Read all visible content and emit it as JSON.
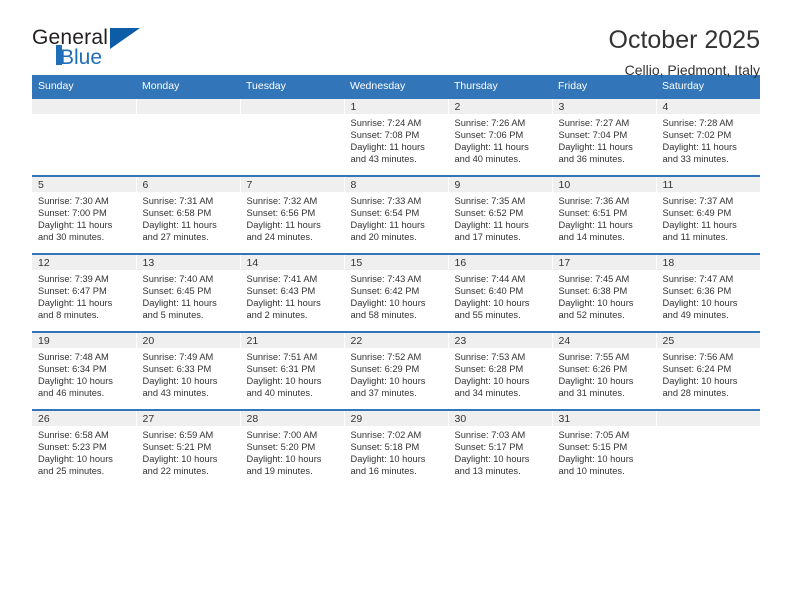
{
  "brand": {
    "name_top": "General",
    "name_bottom": "Blue",
    "accent_color": "#1f6fb8",
    "flag_color": "#0c5ca8"
  },
  "header": {
    "title": "October 2025",
    "location": "Cellio, Piedmont, Italy"
  },
  "theme": {
    "header_row_bg": "#3275b8",
    "daynum_strip_bg": "#efefef",
    "text_color": "#333333"
  },
  "weekday_headers": [
    "Sunday",
    "Monday",
    "Tuesday",
    "Wednesday",
    "Thursday",
    "Friday",
    "Saturday"
  ],
  "weeks": [
    [
      {
        "day": "",
        "empty": true,
        "sunrise": "",
        "sunset": "",
        "daylight_line1": "",
        "daylight_line2": ""
      },
      {
        "day": "",
        "empty": true,
        "sunrise": "",
        "sunset": "",
        "daylight_line1": "",
        "daylight_line2": ""
      },
      {
        "day": "",
        "empty": true,
        "sunrise": "",
        "sunset": "",
        "daylight_line1": "",
        "daylight_line2": ""
      },
      {
        "day": "1",
        "empty": false,
        "sunrise": "Sunrise: 7:24 AM",
        "sunset": "Sunset: 7:08 PM",
        "daylight_line1": "Daylight: 11 hours",
        "daylight_line2": "and 43 minutes."
      },
      {
        "day": "2",
        "empty": false,
        "sunrise": "Sunrise: 7:26 AM",
        "sunset": "Sunset: 7:06 PM",
        "daylight_line1": "Daylight: 11 hours",
        "daylight_line2": "and 40 minutes."
      },
      {
        "day": "3",
        "empty": false,
        "sunrise": "Sunrise: 7:27 AM",
        "sunset": "Sunset: 7:04 PM",
        "daylight_line1": "Daylight: 11 hours",
        "daylight_line2": "and 36 minutes."
      },
      {
        "day": "4",
        "empty": false,
        "sunrise": "Sunrise: 7:28 AM",
        "sunset": "Sunset: 7:02 PM",
        "daylight_line1": "Daylight: 11 hours",
        "daylight_line2": "and 33 minutes."
      }
    ],
    [
      {
        "day": "5",
        "empty": false,
        "sunrise": "Sunrise: 7:30 AM",
        "sunset": "Sunset: 7:00 PM",
        "daylight_line1": "Daylight: 11 hours",
        "daylight_line2": "and 30 minutes."
      },
      {
        "day": "6",
        "empty": false,
        "sunrise": "Sunrise: 7:31 AM",
        "sunset": "Sunset: 6:58 PM",
        "daylight_line1": "Daylight: 11 hours",
        "daylight_line2": "and 27 minutes."
      },
      {
        "day": "7",
        "empty": false,
        "sunrise": "Sunrise: 7:32 AM",
        "sunset": "Sunset: 6:56 PM",
        "daylight_line1": "Daylight: 11 hours",
        "daylight_line2": "and 24 minutes."
      },
      {
        "day": "8",
        "empty": false,
        "sunrise": "Sunrise: 7:33 AM",
        "sunset": "Sunset: 6:54 PM",
        "daylight_line1": "Daylight: 11 hours",
        "daylight_line2": "and 20 minutes."
      },
      {
        "day": "9",
        "empty": false,
        "sunrise": "Sunrise: 7:35 AM",
        "sunset": "Sunset: 6:52 PM",
        "daylight_line1": "Daylight: 11 hours",
        "daylight_line2": "and 17 minutes."
      },
      {
        "day": "10",
        "empty": false,
        "sunrise": "Sunrise: 7:36 AM",
        "sunset": "Sunset: 6:51 PM",
        "daylight_line1": "Daylight: 11 hours",
        "daylight_line2": "and 14 minutes."
      },
      {
        "day": "11",
        "empty": false,
        "sunrise": "Sunrise: 7:37 AM",
        "sunset": "Sunset: 6:49 PM",
        "daylight_line1": "Daylight: 11 hours",
        "daylight_line2": "and 11 minutes."
      }
    ],
    [
      {
        "day": "12",
        "empty": false,
        "sunrise": "Sunrise: 7:39 AM",
        "sunset": "Sunset: 6:47 PM",
        "daylight_line1": "Daylight: 11 hours",
        "daylight_line2": "and 8 minutes."
      },
      {
        "day": "13",
        "empty": false,
        "sunrise": "Sunrise: 7:40 AM",
        "sunset": "Sunset: 6:45 PM",
        "daylight_line1": "Daylight: 11 hours",
        "daylight_line2": "and 5 minutes."
      },
      {
        "day": "14",
        "empty": false,
        "sunrise": "Sunrise: 7:41 AM",
        "sunset": "Sunset: 6:43 PM",
        "daylight_line1": "Daylight: 11 hours",
        "daylight_line2": "and 2 minutes."
      },
      {
        "day": "15",
        "empty": false,
        "sunrise": "Sunrise: 7:43 AM",
        "sunset": "Sunset: 6:42 PM",
        "daylight_line1": "Daylight: 10 hours",
        "daylight_line2": "and 58 minutes."
      },
      {
        "day": "16",
        "empty": false,
        "sunrise": "Sunrise: 7:44 AM",
        "sunset": "Sunset: 6:40 PM",
        "daylight_line1": "Daylight: 10 hours",
        "daylight_line2": "and 55 minutes."
      },
      {
        "day": "17",
        "empty": false,
        "sunrise": "Sunrise: 7:45 AM",
        "sunset": "Sunset: 6:38 PM",
        "daylight_line1": "Daylight: 10 hours",
        "daylight_line2": "and 52 minutes."
      },
      {
        "day": "18",
        "empty": false,
        "sunrise": "Sunrise: 7:47 AM",
        "sunset": "Sunset: 6:36 PM",
        "daylight_line1": "Daylight: 10 hours",
        "daylight_line2": "and 49 minutes."
      }
    ],
    [
      {
        "day": "19",
        "empty": false,
        "sunrise": "Sunrise: 7:48 AM",
        "sunset": "Sunset: 6:34 PM",
        "daylight_line1": "Daylight: 10 hours",
        "daylight_line2": "and 46 minutes."
      },
      {
        "day": "20",
        "empty": false,
        "sunrise": "Sunrise: 7:49 AM",
        "sunset": "Sunset: 6:33 PM",
        "daylight_line1": "Daylight: 10 hours",
        "daylight_line2": "and 43 minutes."
      },
      {
        "day": "21",
        "empty": false,
        "sunrise": "Sunrise: 7:51 AM",
        "sunset": "Sunset: 6:31 PM",
        "daylight_line1": "Daylight: 10 hours",
        "daylight_line2": "and 40 minutes."
      },
      {
        "day": "22",
        "empty": false,
        "sunrise": "Sunrise: 7:52 AM",
        "sunset": "Sunset: 6:29 PM",
        "daylight_line1": "Daylight: 10 hours",
        "daylight_line2": "and 37 minutes."
      },
      {
        "day": "23",
        "empty": false,
        "sunrise": "Sunrise: 7:53 AM",
        "sunset": "Sunset: 6:28 PM",
        "daylight_line1": "Daylight: 10 hours",
        "daylight_line2": "and 34 minutes."
      },
      {
        "day": "24",
        "empty": false,
        "sunrise": "Sunrise: 7:55 AM",
        "sunset": "Sunset: 6:26 PM",
        "daylight_line1": "Daylight: 10 hours",
        "daylight_line2": "and 31 minutes."
      },
      {
        "day": "25",
        "empty": false,
        "sunrise": "Sunrise: 7:56 AM",
        "sunset": "Sunset: 6:24 PM",
        "daylight_line1": "Daylight: 10 hours",
        "daylight_line2": "and 28 minutes."
      }
    ],
    [
      {
        "day": "26",
        "empty": false,
        "sunrise": "Sunrise: 6:58 AM",
        "sunset": "Sunset: 5:23 PM",
        "daylight_line1": "Daylight: 10 hours",
        "daylight_line2": "and 25 minutes."
      },
      {
        "day": "27",
        "empty": false,
        "sunrise": "Sunrise: 6:59 AM",
        "sunset": "Sunset: 5:21 PM",
        "daylight_line1": "Daylight: 10 hours",
        "daylight_line2": "and 22 minutes."
      },
      {
        "day": "28",
        "empty": false,
        "sunrise": "Sunrise: 7:00 AM",
        "sunset": "Sunset: 5:20 PM",
        "daylight_line1": "Daylight: 10 hours",
        "daylight_line2": "and 19 minutes."
      },
      {
        "day": "29",
        "empty": false,
        "sunrise": "Sunrise: 7:02 AM",
        "sunset": "Sunset: 5:18 PM",
        "daylight_line1": "Daylight: 10 hours",
        "daylight_line2": "and 16 minutes."
      },
      {
        "day": "30",
        "empty": false,
        "sunrise": "Sunrise: 7:03 AM",
        "sunset": "Sunset: 5:17 PM",
        "daylight_line1": "Daylight: 10 hours",
        "daylight_line2": "and 13 minutes."
      },
      {
        "day": "31",
        "empty": false,
        "sunrise": "Sunrise: 7:05 AM",
        "sunset": "Sunset: 5:15 PM",
        "daylight_line1": "Daylight: 10 hours",
        "daylight_line2": "and 10 minutes."
      },
      {
        "day": "",
        "empty": true,
        "sunrise": "",
        "sunset": "",
        "daylight_line1": "",
        "daylight_line2": ""
      }
    ]
  ]
}
